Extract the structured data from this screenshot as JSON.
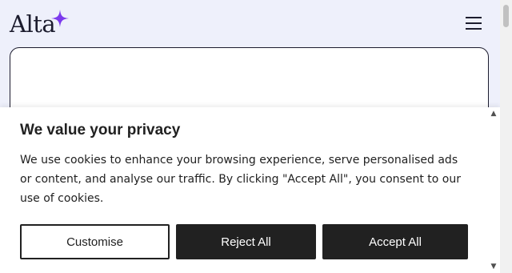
{
  "header": {
    "logo_text": "Alta",
    "menu_icon": "hamburger-menu-icon"
  },
  "cookie_banner": {
    "title": "We value your privacy",
    "text": "We use cookies to enhance your browsing experience, serve personalised ads or content, and analyse our traffic. By clicking \"Accept All\", you consent to our use of cookies.",
    "buttons": {
      "customise": "Customise",
      "reject": "Reject All",
      "accept": "Accept All"
    },
    "scroll_up_glyph": "▲",
    "scroll_down_glyph": "▼"
  },
  "colors": {
    "header_bg": "#eef0fb",
    "accent_star": "#7c3aed",
    "button_dark": "#212121",
    "text": "#212121"
  }
}
